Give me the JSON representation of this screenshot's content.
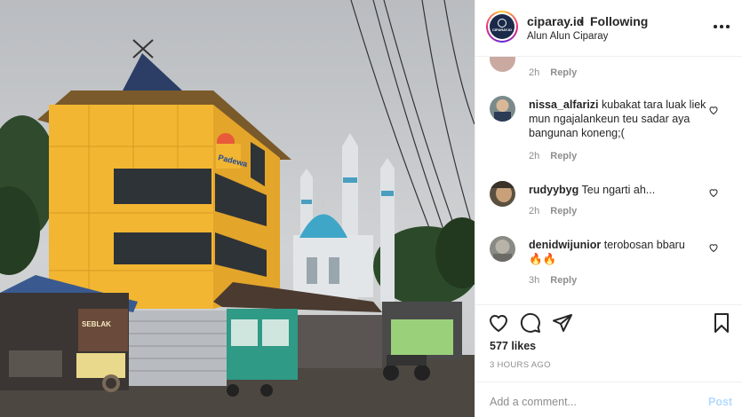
{
  "post": {
    "username": "ciparay.id",
    "dot": "•",
    "follow_state": "Following",
    "location": "Alun Alun Ciparay",
    "avatar_logo_text": "CIPARAY.ID"
  },
  "comments": [
    {
      "user": "",
      "text": "",
      "time": "2h",
      "reply": "Reply"
    },
    {
      "user": "nissa_alfarizi",
      "text": "kubakat tara luak liek mun ngajalankeun teu sadar aya bangunan koneng;(",
      "time": "2h",
      "reply": "Reply"
    },
    {
      "user": "rudyybyg",
      "text": "Teu ngarti ah...",
      "time": "2h",
      "reply": "Reply"
    },
    {
      "user": "denidwijunior",
      "text": "terobosan bbaru",
      "emoji": "🔥🔥",
      "time": "3h",
      "reply": "Reply"
    }
  ],
  "actions": {
    "likes": "577 likes",
    "posted": "3 HOURS AGO",
    "add_comment_placeholder": "Add a comment...",
    "post_label": "Post"
  },
  "photo": {
    "building_sign": "Padewa",
    "stall_sign": "SEBLAK"
  },
  "colors": {
    "text": "#262626",
    "secondary": "#8e8e8e",
    "border": "#efefef",
    "post_disabled": "#b3dbff",
    "building_yellow": "#f2b632",
    "mosque_dome": "#3fa6c8"
  }
}
